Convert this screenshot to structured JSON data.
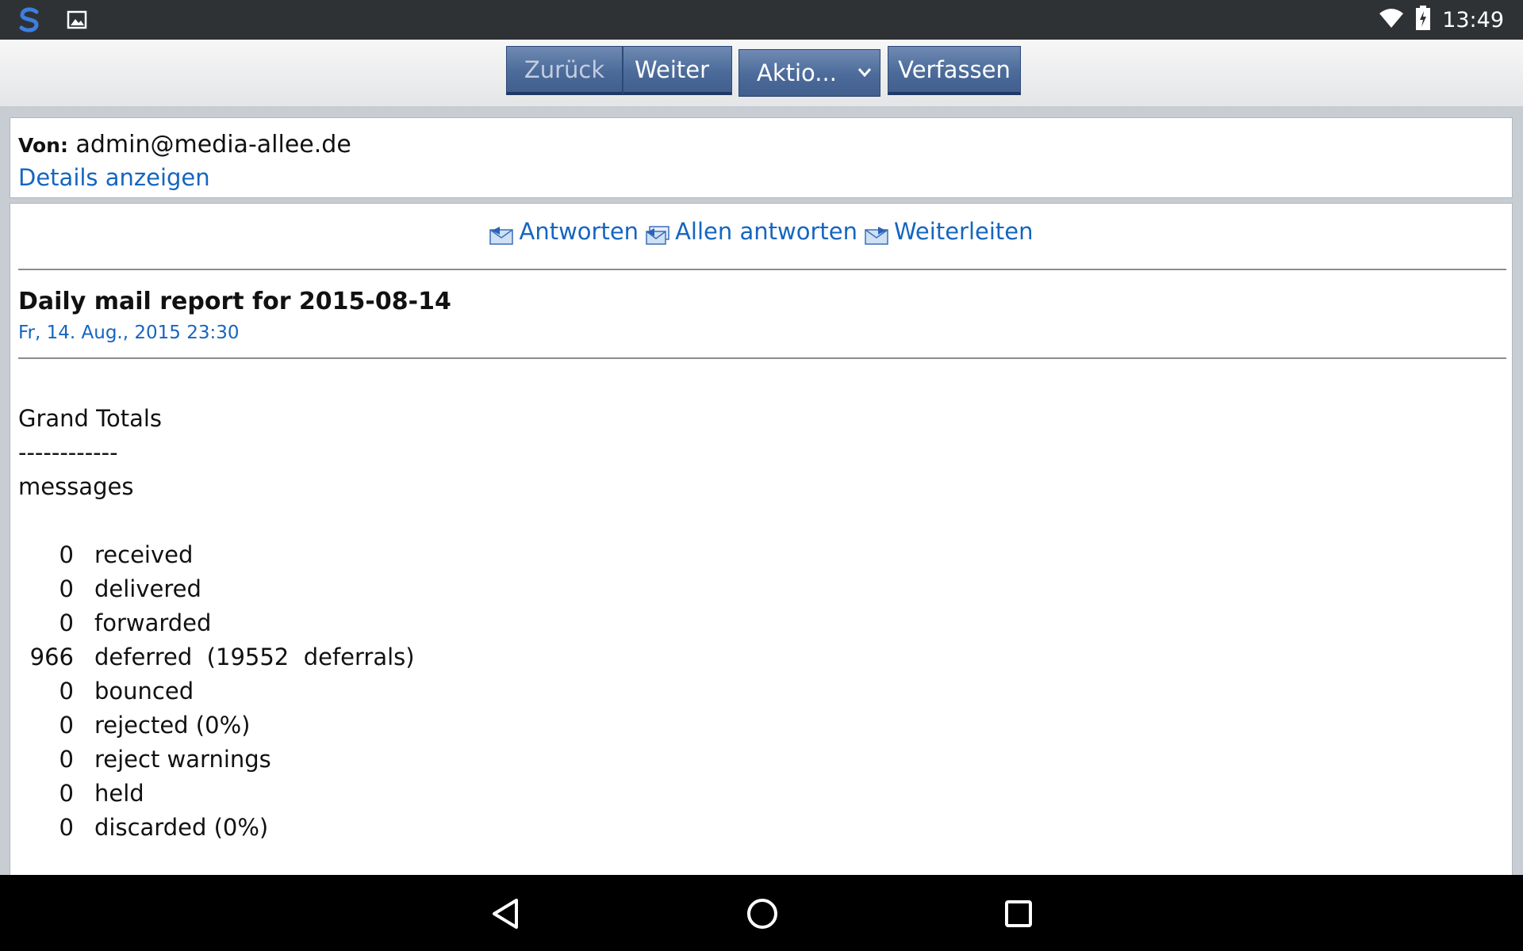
{
  "status_bar": {
    "time": "13:49",
    "icons": [
      "sync-app-icon",
      "image-notification-icon",
      "wifi-icon",
      "battery-charging-icon"
    ]
  },
  "toolbar": {
    "back_label": "Zurück",
    "next_label": "Weiter",
    "actions_select": "Aktio...",
    "compose_label": "Verfassen"
  },
  "message": {
    "from_label": "Von:",
    "from_value": "admin@media-allee.de",
    "details_link": "Details anzeigen",
    "reply": "Antworten",
    "reply_all": "Allen antworten",
    "forward": "Weiterleiten",
    "subject": "Daily mail report for 2015-08-14",
    "date": "Fr, 14. Aug., 2015 23:30",
    "report": {
      "heading": "Grand Totals",
      "underline": "------------",
      "section": "messages",
      "rows": [
        {
          "num": "0",
          "label": "received"
        },
        {
          "num": "0",
          "label": "delivered"
        },
        {
          "num": "0",
          "label": "forwarded"
        },
        {
          "num": "966",
          "label": "deferred  (19552  deferrals)"
        },
        {
          "num": "0",
          "label": "bounced"
        },
        {
          "num": "0",
          "label": "rejected (0%)"
        },
        {
          "num": "0",
          "label": "reject warnings"
        },
        {
          "num": "0",
          "label": "held"
        },
        {
          "num": "0",
          "label": "discarded (0%)"
        }
      ]
    }
  },
  "colors": {
    "status_bar": "#2f3235",
    "button": "#4c6b9a",
    "link": "#1565c0",
    "nav_bar": "#000000"
  }
}
